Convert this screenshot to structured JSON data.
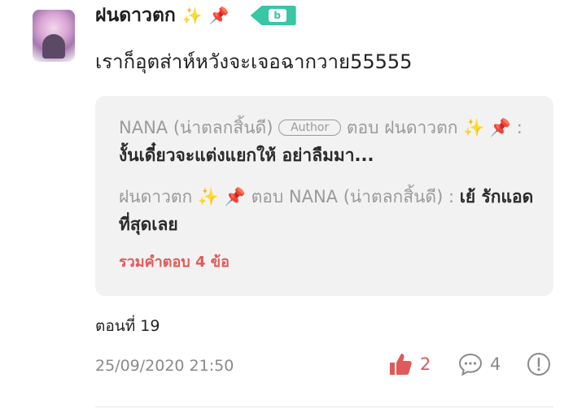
{
  "comment": {
    "username": "ฝนดาวตก",
    "username_emojis": [
      "✨",
      "📌"
    ],
    "level_badge": "b",
    "text": "เราก็อุตส่าห์หวังจะเจอฉากวาย55555"
  },
  "replies": [
    {
      "author": "NANA (น่าตลกสิ้นดี)",
      "author_tag": "Author",
      "reply_word": "ตอบ",
      "reply_to": "ฝนดาวตก",
      "emojis": "✨ 📌",
      "separator": ":",
      "text": "งั้นเดี๋ยวจะแต่งแยกให้ อย่าลืมมา..."
    },
    {
      "author": "ฝนดาวตก",
      "emojis": "✨ 📌",
      "reply_word": "ตอบ",
      "reply_to": "NANA (น่าตลกสิ้นดี)",
      "separator": ":",
      "text": "เย้ รักแอดที่สุดเลย"
    }
  ],
  "more_replies": "รวมคำตอบ 4 ข้อ",
  "episode": "ตอนที่ 19",
  "timestamp": "25/09/2020 21:50",
  "actions": {
    "likes": "2",
    "comments": "4"
  },
  "colors": {
    "accent_red": "#e05a5a",
    "badge_green": "#38c6a4"
  },
  "icons": [
    "thumbs-up-icon",
    "speech-bubble-icon",
    "report-icon"
  ]
}
